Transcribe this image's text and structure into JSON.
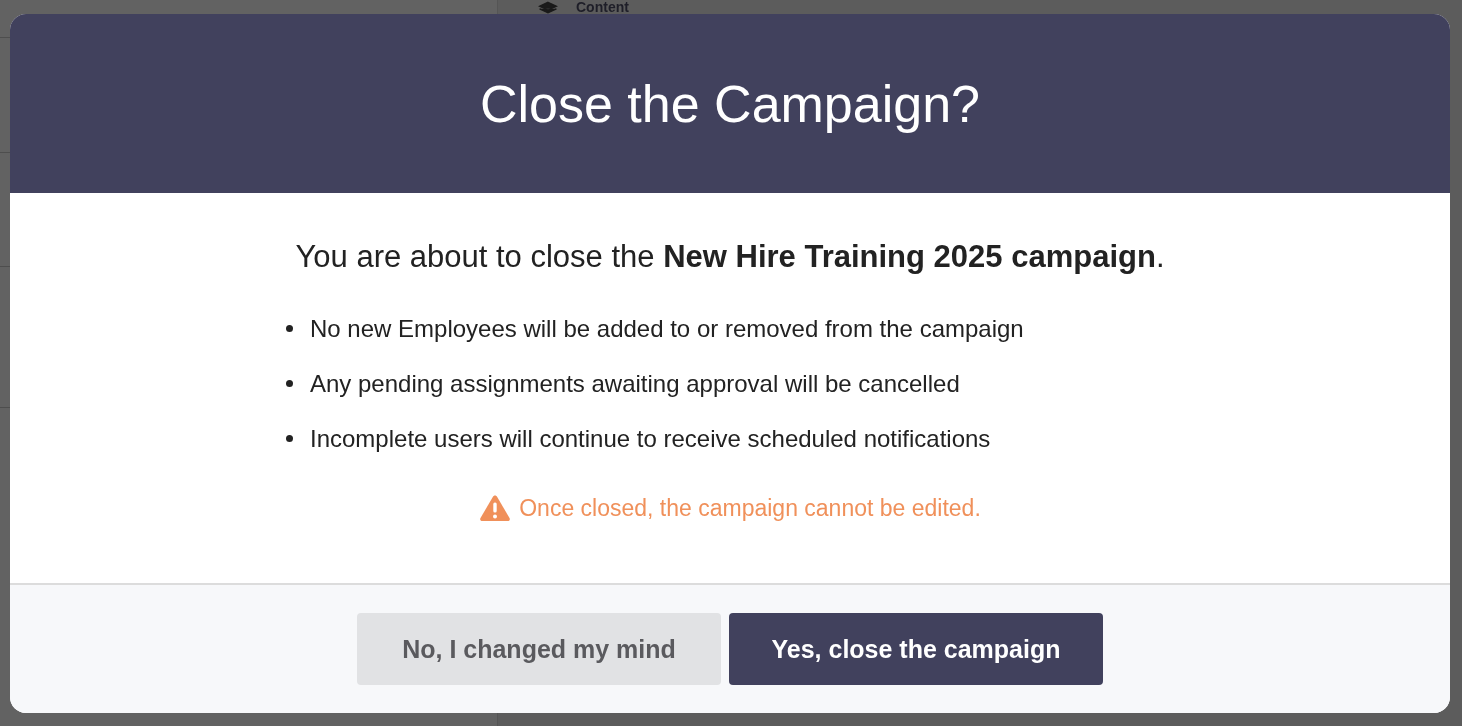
{
  "background": {
    "heading": "Content"
  },
  "dialog": {
    "title": "Close the Campaign?",
    "intro": "You are about to close the **New Hire Training 2025 campaign**.",
    "bullets": [
      "No new Employees will be added to or removed from the campaign",
      "Any pending assignments awaiting approval will be cancelled",
      "Incomplete users will continue to receive scheduled notifications"
    ],
    "warning": "Once closed, the campaign cannot be edited.",
    "buttons": [
      {
        "label": "No, I changed my mind",
        "kind": "secondary"
      },
      {
        "label": "Yes, close the campaign",
        "kind": "primary"
      }
    ]
  }
}
